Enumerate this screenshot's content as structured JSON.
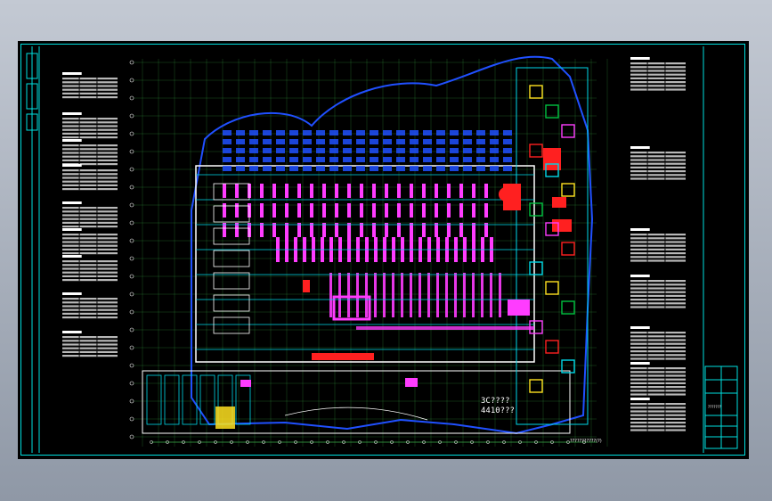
{
  "app": {
    "background_colors": [
      "#c3c9d3",
      "#8f98a6"
    ],
    "viewport_background": "#000000"
  },
  "drawing": {
    "frame_color": "#00e0e0",
    "palette": {
      "wall": "#ffffff",
      "grid": "#3cb04a",
      "outline": "#2050ff",
      "fixture": "#ff3cff",
      "cyan": "#00d8e8",
      "red": "#ff2020",
      "yellow": "#ffe020",
      "green": "#00c040"
    },
    "annotation_line1": "3C????",
    "annotation_line2": "4410???",
    "bottom_caption": "???????????(?)",
    "title_block_label": "???????"
  },
  "left_tables": {
    "count": 11
  },
  "right_tables": {
    "count": 8
  }
}
